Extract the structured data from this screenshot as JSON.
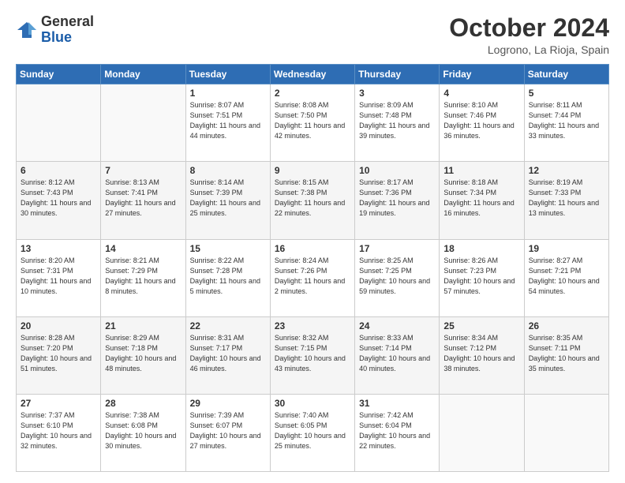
{
  "header": {
    "logo_line1": "General",
    "logo_line2": "Blue",
    "month": "October 2024",
    "location": "Logrono, La Rioja, Spain"
  },
  "days_of_week": [
    "Sunday",
    "Monday",
    "Tuesday",
    "Wednesday",
    "Thursday",
    "Friday",
    "Saturday"
  ],
  "weeks": [
    [
      {
        "day": "",
        "info": ""
      },
      {
        "day": "",
        "info": ""
      },
      {
        "day": "1",
        "info": "Sunrise: 8:07 AM\nSunset: 7:51 PM\nDaylight: 11 hours and 44 minutes."
      },
      {
        "day": "2",
        "info": "Sunrise: 8:08 AM\nSunset: 7:50 PM\nDaylight: 11 hours and 42 minutes."
      },
      {
        "day": "3",
        "info": "Sunrise: 8:09 AM\nSunset: 7:48 PM\nDaylight: 11 hours and 39 minutes."
      },
      {
        "day": "4",
        "info": "Sunrise: 8:10 AM\nSunset: 7:46 PM\nDaylight: 11 hours and 36 minutes."
      },
      {
        "day": "5",
        "info": "Sunrise: 8:11 AM\nSunset: 7:44 PM\nDaylight: 11 hours and 33 minutes."
      }
    ],
    [
      {
        "day": "6",
        "info": "Sunrise: 8:12 AM\nSunset: 7:43 PM\nDaylight: 11 hours and 30 minutes."
      },
      {
        "day": "7",
        "info": "Sunrise: 8:13 AM\nSunset: 7:41 PM\nDaylight: 11 hours and 27 minutes."
      },
      {
        "day": "8",
        "info": "Sunrise: 8:14 AM\nSunset: 7:39 PM\nDaylight: 11 hours and 25 minutes."
      },
      {
        "day": "9",
        "info": "Sunrise: 8:15 AM\nSunset: 7:38 PM\nDaylight: 11 hours and 22 minutes."
      },
      {
        "day": "10",
        "info": "Sunrise: 8:17 AM\nSunset: 7:36 PM\nDaylight: 11 hours and 19 minutes."
      },
      {
        "day": "11",
        "info": "Sunrise: 8:18 AM\nSunset: 7:34 PM\nDaylight: 11 hours and 16 minutes."
      },
      {
        "day": "12",
        "info": "Sunrise: 8:19 AM\nSunset: 7:33 PM\nDaylight: 11 hours and 13 minutes."
      }
    ],
    [
      {
        "day": "13",
        "info": "Sunrise: 8:20 AM\nSunset: 7:31 PM\nDaylight: 11 hours and 10 minutes."
      },
      {
        "day": "14",
        "info": "Sunrise: 8:21 AM\nSunset: 7:29 PM\nDaylight: 11 hours and 8 minutes."
      },
      {
        "day": "15",
        "info": "Sunrise: 8:22 AM\nSunset: 7:28 PM\nDaylight: 11 hours and 5 minutes."
      },
      {
        "day": "16",
        "info": "Sunrise: 8:24 AM\nSunset: 7:26 PM\nDaylight: 11 hours and 2 minutes."
      },
      {
        "day": "17",
        "info": "Sunrise: 8:25 AM\nSunset: 7:25 PM\nDaylight: 10 hours and 59 minutes."
      },
      {
        "day": "18",
        "info": "Sunrise: 8:26 AM\nSunset: 7:23 PM\nDaylight: 10 hours and 57 minutes."
      },
      {
        "day": "19",
        "info": "Sunrise: 8:27 AM\nSunset: 7:21 PM\nDaylight: 10 hours and 54 minutes."
      }
    ],
    [
      {
        "day": "20",
        "info": "Sunrise: 8:28 AM\nSunset: 7:20 PM\nDaylight: 10 hours and 51 minutes."
      },
      {
        "day": "21",
        "info": "Sunrise: 8:29 AM\nSunset: 7:18 PM\nDaylight: 10 hours and 48 minutes."
      },
      {
        "day": "22",
        "info": "Sunrise: 8:31 AM\nSunset: 7:17 PM\nDaylight: 10 hours and 46 minutes."
      },
      {
        "day": "23",
        "info": "Sunrise: 8:32 AM\nSunset: 7:15 PM\nDaylight: 10 hours and 43 minutes."
      },
      {
        "day": "24",
        "info": "Sunrise: 8:33 AM\nSunset: 7:14 PM\nDaylight: 10 hours and 40 minutes."
      },
      {
        "day": "25",
        "info": "Sunrise: 8:34 AM\nSunset: 7:12 PM\nDaylight: 10 hours and 38 minutes."
      },
      {
        "day": "26",
        "info": "Sunrise: 8:35 AM\nSunset: 7:11 PM\nDaylight: 10 hours and 35 minutes."
      }
    ],
    [
      {
        "day": "27",
        "info": "Sunrise: 7:37 AM\nSunset: 6:10 PM\nDaylight: 10 hours and 32 minutes."
      },
      {
        "day": "28",
        "info": "Sunrise: 7:38 AM\nSunset: 6:08 PM\nDaylight: 10 hours and 30 minutes."
      },
      {
        "day": "29",
        "info": "Sunrise: 7:39 AM\nSunset: 6:07 PM\nDaylight: 10 hours and 27 minutes."
      },
      {
        "day": "30",
        "info": "Sunrise: 7:40 AM\nSunset: 6:05 PM\nDaylight: 10 hours and 25 minutes."
      },
      {
        "day": "31",
        "info": "Sunrise: 7:42 AM\nSunset: 6:04 PM\nDaylight: 10 hours and 22 minutes."
      },
      {
        "day": "",
        "info": ""
      },
      {
        "day": "",
        "info": ""
      }
    ]
  ]
}
